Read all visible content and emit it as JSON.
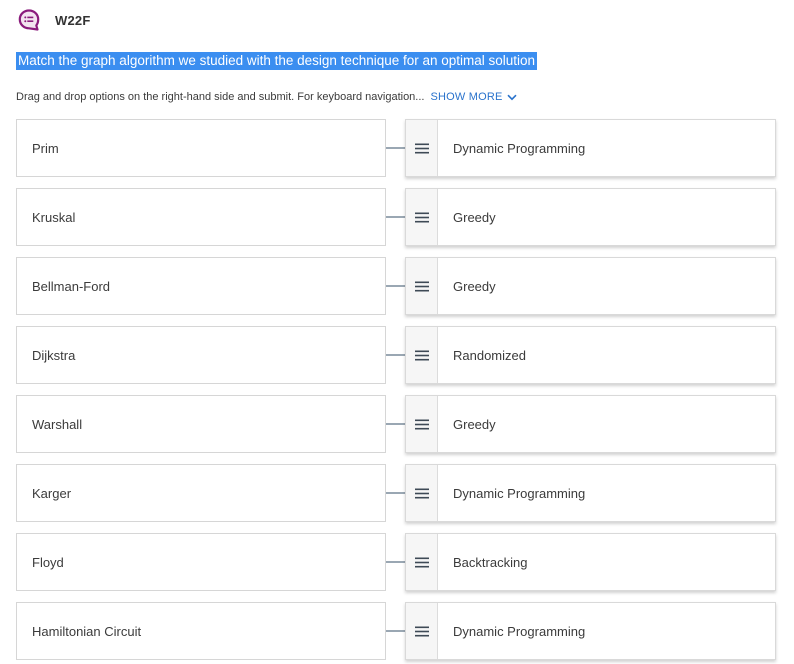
{
  "header": {
    "icon": "chat-list-icon",
    "title": "W22F"
  },
  "question": {
    "text": "Match the graph algorithm we studied with the design technique for an optimal solution"
  },
  "instructions": {
    "text": "Drag and drop options on the right-hand side and submit. For keyboard navigation...",
    "show_more_label": "SHOW MORE",
    "show_more_icon": "chevron-down-icon"
  },
  "colors": {
    "accent": "#2a73cc",
    "selection": "#3b8ef0",
    "brand_icon": "#8a1c7c",
    "connector": "#9aa7b3"
  },
  "pairs": [
    {
      "prompt": "Prim",
      "answer": "Dynamic Programming"
    },
    {
      "prompt": "Kruskal",
      "answer": "Greedy"
    },
    {
      "prompt": "Bellman-Ford",
      "answer": "Greedy"
    },
    {
      "prompt": "Dijkstra",
      "answer": "Randomized"
    },
    {
      "prompt": "Warshall",
      "answer": "Greedy"
    },
    {
      "prompt": "Karger",
      "answer": "Dynamic Programming"
    },
    {
      "prompt": "Floyd",
      "answer": "Backtracking"
    },
    {
      "prompt": "Hamiltonian Circuit",
      "answer": "Dynamic Programming"
    }
  ]
}
